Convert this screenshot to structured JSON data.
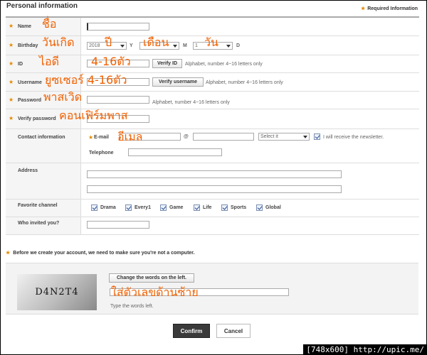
{
  "header": {
    "title": "Personal information",
    "required": "Required Information"
  },
  "fields": {
    "name": "Name",
    "birthday": "Birthday",
    "id": "ID",
    "username": "Username",
    "password": "Password",
    "verify_password": "Verify password",
    "contact": "Contact information",
    "email": "E-mail",
    "telephone": "Telephone",
    "address": "Address",
    "favorite": "Favorite channel",
    "invited": "Who invited you?"
  },
  "birthday": {
    "year": "2018",
    "y": "Y",
    "m": "M",
    "month": "1",
    "d": "D"
  },
  "buttons": {
    "verify_id": "Verify ID",
    "verify_username": "Verify username",
    "change_words": "Change the words on the left.",
    "confirm": "Confirm",
    "cancel": "Cancel"
  },
  "hints": {
    "id": "Alphabet, number 4~16 letters only",
    "username": "Alphabet, number 4~16 letters only",
    "password": "Alphabet, number 4~16 letters only",
    "captcha": "Type the words left."
  },
  "email": {
    "at": "@",
    "domain_select": "Select it",
    "newsletter": "I will receive the newsletter."
  },
  "channels": [
    "Drama",
    "Every1",
    "Game",
    "Life",
    "Sports",
    "Global"
  ],
  "captcha": {
    "intro": "Before we create your account, we need to make sure you're not a computer.",
    "word": "D4N2T4"
  },
  "thai": {
    "name": "ชื่อ",
    "birthday": "วันเกิด",
    "year": "ปี",
    "month": "เดือน",
    "day": "วัน",
    "id": "ไอดี",
    "id_len": "4-16ตัว",
    "username": "ยูซเซอร์ 4-16ตัว",
    "password": "พาสเวิด",
    "verify": "คอนเฟิร์มพาส",
    "email": "อีเมล",
    "captcha": "ใส่ตัวเลขด้านซ้าย"
  },
  "footer": {
    "size": "[748x600]",
    "url": "http://upic.me/"
  },
  "colors": {
    "star": "#e68a00",
    "thai": "#f06000",
    "confirm_bg": "#3a3a3a"
  }
}
